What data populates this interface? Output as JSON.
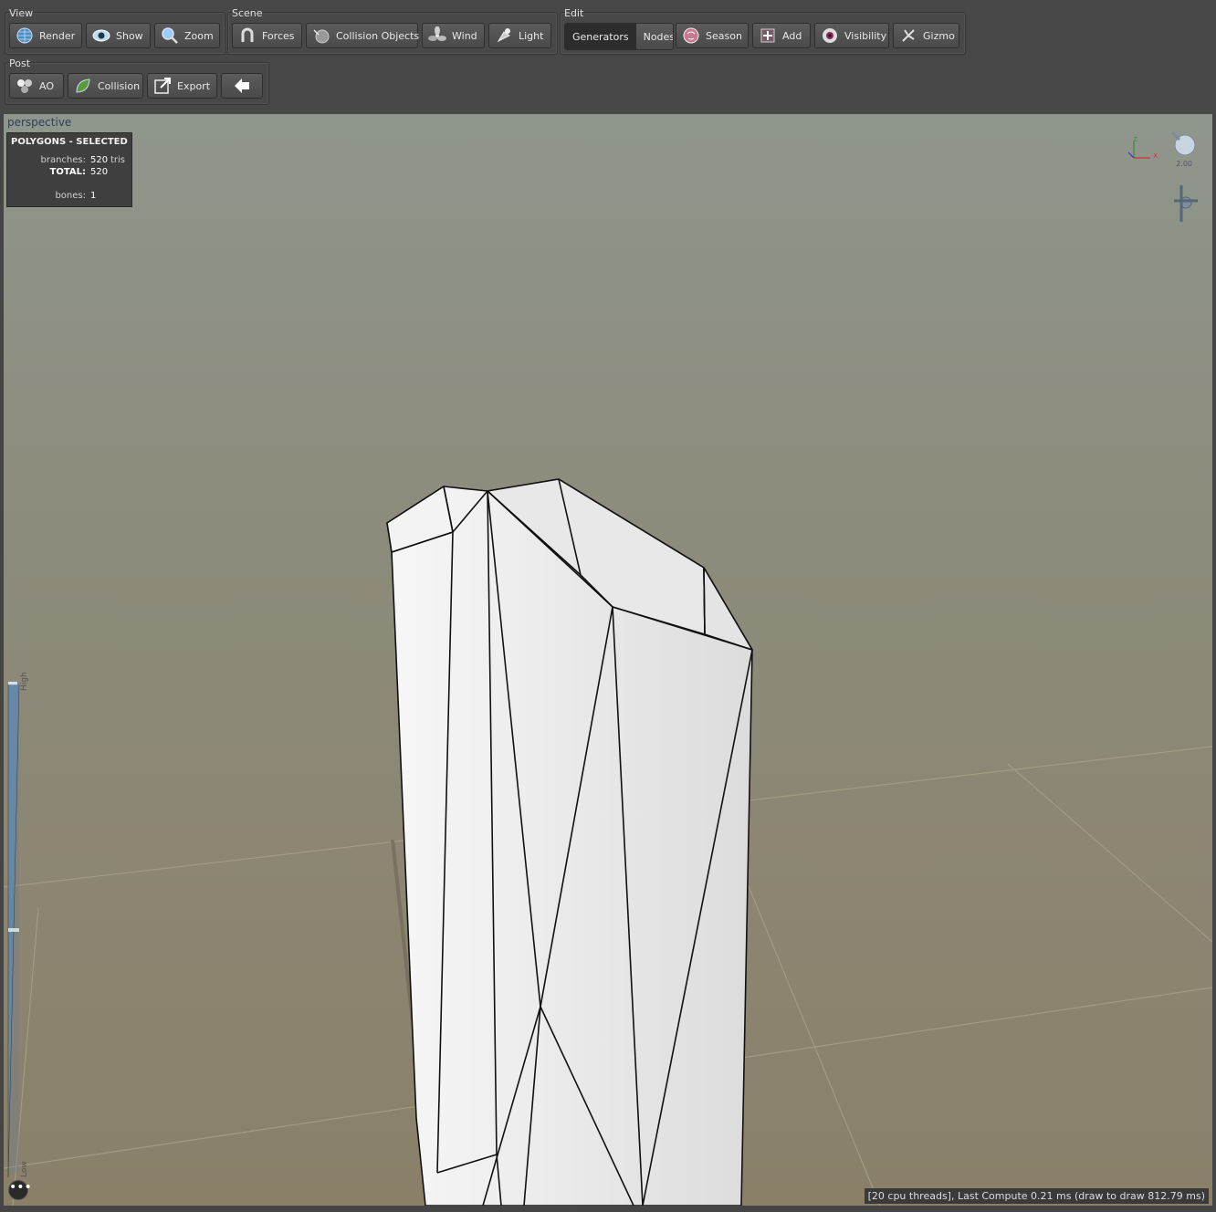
{
  "toolbar": {
    "view": {
      "label": "View",
      "buttons": [
        "Render",
        "Show",
        "Zoom"
      ]
    },
    "scene": {
      "label": "Scene",
      "buttons": [
        "Forces",
        "Collision Objects",
        "Wind",
        "Light"
      ]
    },
    "edit": {
      "label": "Edit",
      "tab_generators": "Generators",
      "tab_nodes": "Nodes",
      "buttons": [
        "Season",
        "Add",
        "Visibility",
        "Gizmo"
      ]
    },
    "post": {
      "label": "Post",
      "buttons": [
        "AO",
        "Collision",
        "Export"
      ]
    }
  },
  "viewport": {
    "camera_label": "perspective",
    "stats": {
      "title": "POLYGONS - SELECTED",
      "branches_label": "branches:",
      "branches_value": "520",
      "branches_unit": "tris",
      "total_label": "TOTAL:",
      "total_value": "520",
      "bones_label": "bones:",
      "bones_value": "1"
    },
    "light_intensity": "2.00",
    "axis": {
      "z": "Z",
      "x": "X"
    },
    "lod_slider": {
      "high": "High",
      "low": "Low"
    },
    "status": "[20 cpu threads], Last Compute 0.21 ms (draw to draw 812.79 ms)",
    "more_button": "•••"
  },
  "colors": {
    "toolbar_bg": "#484848",
    "sky_top": "#8e958a",
    "ground": "#8a826a",
    "mesh": "#f2f2f2"
  }
}
